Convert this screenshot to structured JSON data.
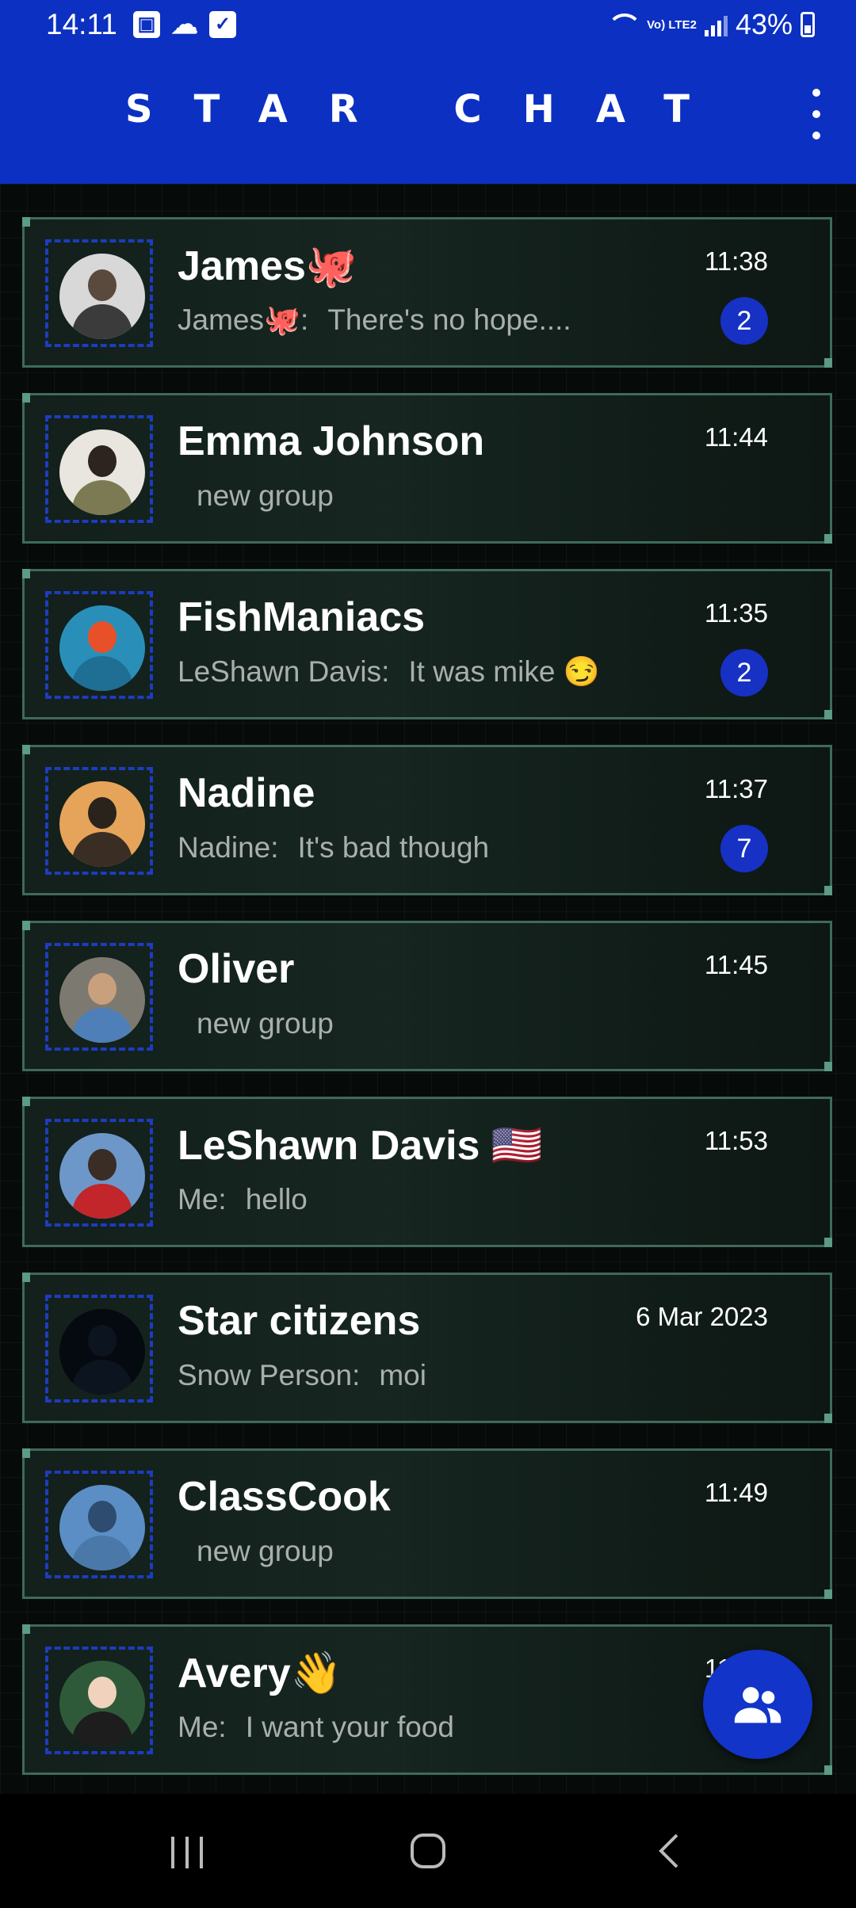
{
  "status": {
    "time": "14:11",
    "icons": [
      "gallery-icon",
      "cloud-icon",
      "check-icon"
    ],
    "network": "Vo) LTE2",
    "battery": "43%"
  },
  "header": {
    "title": "STAR CHAT"
  },
  "chats": [
    {
      "name": "James🐙",
      "sender": "James🐙:",
      "message": "There's no hope....",
      "time": "11:38",
      "unread": "2",
      "avatar_colors": [
        "#d8d8d8",
        "#5a4a3d",
        "#3b3b3b"
      ]
    },
    {
      "name": "Emma Johnson",
      "sender": "",
      "message": "new group",
      "time": "11:44",
      "unread": "",
      "avatar_colors": [
        "#e9e6df",
        "#2d2420",
        "#7b7a52"
      ]
    },
    {
      "name": "FishManiacs",
      "sender": "LeShawn Davis:",
      "message": "It was mike 😏",
      "time": "11:35",
      "unread": "2",
      "avatar_colors": [
        "#2a8fb8",
        "#e8502a",
        "#1f6e93"
      ]
    },
    {
      "name": "Nadine",
      "sender": "Nadine:",
      "message": "It's bad though",
      "time": "11:37",
      "unread": "7",
      "avatar_colors": [
        "#e6a45a",
        "#2a231c",
        "#3a2e24"
      ]
    },
    {
      "name": "Oliver",
      "sender": "",
      "message": "new group",
      "time": "11:45",
      "unread": "",
      "avatar_colors": [
        "#7c7a70",
        "#c9a07e",
        "#4f7fb8"
      ]
    },
    {
      "name": "LeShawn Davis 🇺🇸",
      "sender": "Me:",
      "message": "hello",
      "time": "11:53",
      "unread": "",
      "avatar_colors": [
        "#6d97c8",
        "#3a2d25",
        "#c2262a"
      ]
    },
    {
      "name": "Star citizens",
      "sender": "Snow Person:",
      "message": "moi",
      "time": "6 Mar 2023",
      "unread": "",
      "avatar_colors": [
        "#050a10",
        "#0c1420",
        "#0c1420"
      ]
    },
    {
      "name": "ClassCook",
      "sender": "",
      "message": "new group",
      "time": "11:49",
      "unread": "",
      "avatar_colors": [
        "#5b8ec4",
        "#2d4c70",
        "#4a78a8"
      ]
    },
    {
      "name": "Avery👋",
      "sender": "Me:",
      "message": "I want your food",
      "time": "11:50",
      "unread": "",
      "avatar_colors": [
        "#2f5a3a",
        "#f0d2bd",
        "#1d1d1d"
      ]
    }
  ],
  "fab": {
    "icon": "group-icon"
  },
  "navbar": {
    "icons": [
      "recent-apps-icon",
      "home-icon",
      "back-icon"
    ]
  }
}
